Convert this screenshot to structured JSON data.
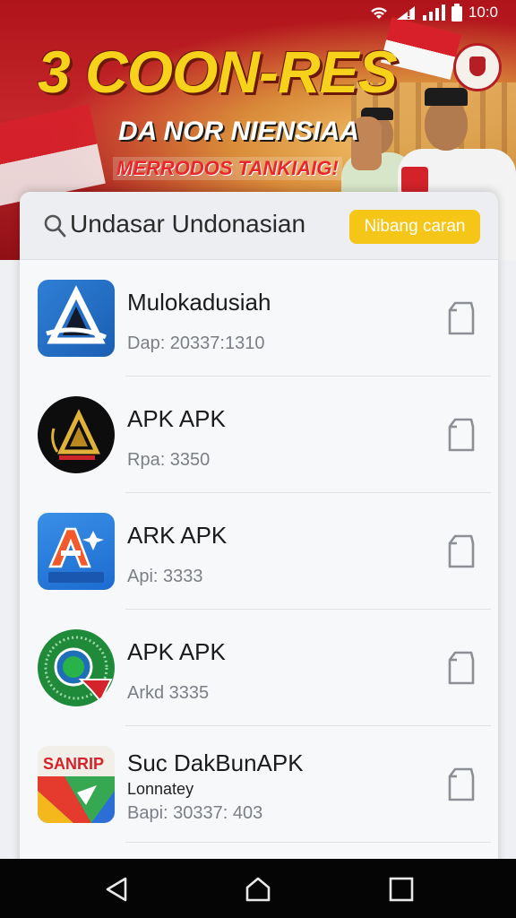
{
  "banner": {
    "headline": "3 COON-RES",
    "subtitle": "DA NOR NIENSIAA",
    "tagline": "MERRODOS TANKIAIG!"
  },
  "status_bar": {
    "time": "10:0",
    "icons": [
      "wifi-icon",
      "signal-alert-icon",
      "cell-signal-icon",
      "battery-icon"
    ]
  },
  "search": {
    "query": "Undasar Undonasian",
    "button_label": "Nibang caran"
  },
  "apps": [
    {
      "name": "Mulokadusiah",
      "subtitle": "",
      "meta": "Dap: 20337:1310",
      "icon": "blue-triangle-logo-icon"
    },
    {
      "name": "APK APK",
      "subtitle": "",
      "meta": "Rpa: 3350",
      "icon": "black-gold-emblem-icon"
    },
    {
      "name": "ARK APK",
      "subtitle": "",
      "meta": "Api: 3333",
      "icon": "blue-letter-a-icon"
    },
    {
      "name": "APK APK",
      "subtitle": "",
      "meta": "Arkd 3335",
      "icon": "green-globe-icon"
    },
    {
      "name": "Suc DakBunAPK",
      "subtitle": "Lonnatey",
      "meta": "Bapi: 30337: 403",
      "icon": "santrip-maps-icon"
    }
  ],
  "navbar": {
    "icons": [
      "back-icon",
      "home-icon",
      "recents-icon"
    ]
  },
  "colors": {
    "banner_red": "#b0141b",
    "headline_yellow": "#f7d21b",
    "button_yellow": "#f5c518",
    "nav_black": "#050505"
  }
}
